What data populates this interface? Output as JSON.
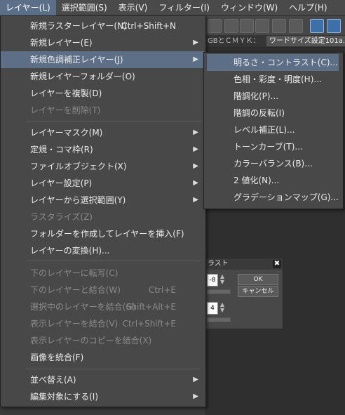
{
  "menubar": {
    "items": [
      "レイヤー(L)",
      "選択範囲(S)",
      "表示(V)",
      "フィルター(I)",
      "ウィンドウ(W)",
      "ヘルプ(H)"
    ]
  },
  "tabs": [
    "GBとＣＭＹＫ：",
    "ワードサイズ設定101a.png"
  ],
  "layer_menu": {
    "items": [
      {
        "label": "新規ラスターレイヤー(N)",
        "shortcut": "Ctrl+Shift+N"
      },
      {
        "label": "新規レイヤー(E)",
        "submenu": true
      },
      {
        "label": "新規色調補正レイヤー(J)",
        "submenu": true,
        "highlighted": true
      },
      {
        "label": "新規レイヤーフォルダー(O)"
      },
      {
        "label": "レイヤーを複製(D)"
      },
      {
        "label": "レイヤーを削除(T)",
        "disabled": true
      },
      {
        "label": "レイヤーマスク(M)",
        "submenu": true
      },
      {
        "label": "定規・コマ枠(R)",
        "submenu": true
      },
      {
        "label": "ファイルオブジェクト(X)",
        "submenu": true
      },
      {
        "label": "レイヤー設定(P)",
        "submenu": true
      },
      {
        "label": "レイヤーから選択範囲(Y)",
        "submenu": true
      },
      {
        "label": "ラスタライズ(Z)",
        "disabled": true
      },
      {
        "label": "フォルダーを作成してレイヤーを挿入(F)"
      },
      {
        "label": "レイヤーの変換(H)..."
      },
      {
        "label": "下のレイヤーに転写(C)",
        "disabled": true
      },
      {
        "label": "下のレイヤーと結合(W)",
        "shortcut": "Ctrl+E",
        "disabled": true
      },
      {
        "label": "選択中のレイヤーを結合(G)",
        "shortcut": "Shift+Alt+E",
        "disabled": true
      },
      {
        "label": "表示レイヤーを結合(V)",
        "shortcut": "Ctrl+Shift+E",
        "disabled": true
      },
      {
        "label": "表示レイヤーのコピーを結合(X)",
        "disabled": true
      },
      {
        "label": "画像を統合(F)"
      },
      {
        "label": "並べ替え(A)",
        "submenu": true
      },
      {
        "label": "編集対象にする(I)",
        "submenu": true
      }
    ]
  },
  "adjustment_submenu": {
    "items": [
      {
        "label": "明るさ・コントラスト(C)...",
        "highlighted": true
      },
      {
        "label": "色相・彩度・明度(H)..."
      },
      {
        "label": "階調化(P)..."
      },
      {
        "label": "階調の反転(I)"
      },
      {
        "label": "レベル補正(L)..."
      },
      {
        "label": "トーンカーブ(T)..."
      },
      {
        "label": "カラーバランス(B)..."
      },
      {
        "label": "2 値化(N)..."
      },
      {
        "label": "グラデーションマップ(G)..."
      }
    ]
  },
  "dialog": {
    "title": "ラスト",
    "ok": "OK",
    "cancel": "キャンセル",
    "value1": "-8",
    "value2": "4"
  },
  "icons": {
    "submenu_arrow": "▶",
    "close": "✖"
  }
}
